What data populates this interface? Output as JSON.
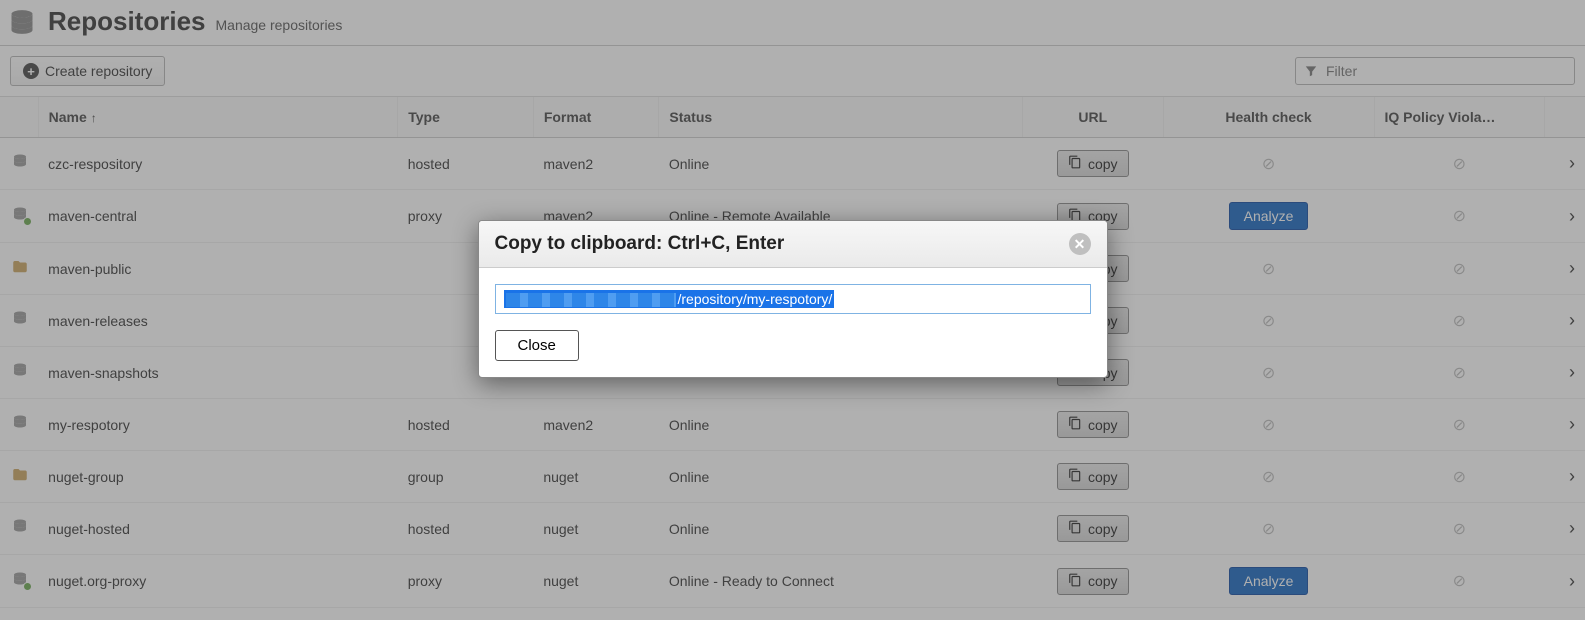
{
  "header": {
    "title": "Repositories",
    "subtitle": "Manage repositories"
  },
  "toolbar": {
    "create_label": "Create repository",
    "filter_placeholder": "Filter"
  },
  "columns": {
    "name": "Name",
    "type": "Type",
    "format": "Format",
    "status": "Status",
    "url": "URL",
    "health": "Health check",
    "iq": "IQ Policy Viola…"
  },
  "copy_label": "copy",
  "analyze_label": "Analyze",
  "rows": [
    {
      "name": "czc-respository",
      "type": "hosted",
      "format": "maven2",
      "status": "Online",
      "icon": "hosted",
      "health": "disabled",
      "iq": "disabled"
    },
    {
      "name": "maven-central",
      "type": "proxy",
      "format": "maven2",
      "status": "Online - Remote Available",
      "icon": "proxy",
      "health": "analyze",
      "iq": "disabled"
    },
    {
      "name": "maven-public",
      "type": "",
      "format": "",
      "status": "",
      "icon": "group",
      "health": "disabled",
      "iq": "disabled"
    },
    {
      "name": "maven-releases",
      "type": "",
      "format": "",
      "status": "",
      "icon": "hosted",
      "health": "disabled",
      "iq": "disabled"
    },
    {
      "name": "maven-snapshots",
      "type": "",
      "format": "",
      "status": "",
      "icon": "hosted",
      "health": "disabled",
      "iq": "disabled"
    },
    {
      "name": "my-respotory",
      "type": "hosted",
      "format": "maven2",
      "status": "Online",
      "icon": "hosted",
      "health": "disabled",
      "iq": "disabled"
    },
    {
      "name": "nuget-group",
      "type": "group",
      "format": "nuget",
      "status": "Online",
      "icon": "group",
      "health": "disabled",
      "iq": "disabled"
    },
    {
      "name": "nuget-hosted",
      "type": "hosted",
      "format": "nuget",
      "status": "Online",
      "icon": "hosted",
      "health": "disabled",
      "iq": "disabled"
    },
    {
      "name": "nuget.org-proxy",
      "type": "proxy",
      "format": "nuget",
      "status": "Online - Ready to Connect",
      "icon": "proxy",
      "health": "analyze",
      "iq": "disabled"
    }
  ],
  "modal": {
    "title": "Copy to clipboard: Ctrl+C, Enter",
    "url_visible_part": "/repository/my-respotory/",
    "close_label": "Close"
  }
}
